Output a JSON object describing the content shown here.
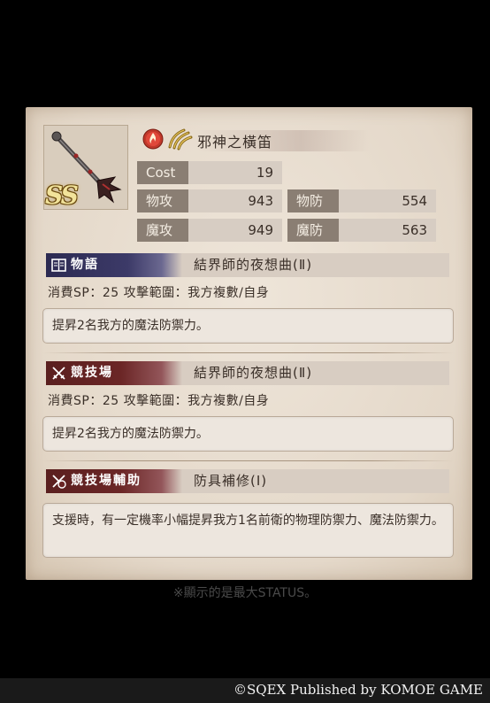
{
  "item": {
    "name": "邪神之橫笛",
    "rank": "SS",
    "element_icon": "fire-element-icon",
    "weapon_type_icon": "claw-weapon-icon"
  },
  "stats": {
    "cost_label": "Cost",
    "cost_value": "19",
    "patk_label": "物攻",
    "patk_value": "943",
    "pdef_label": "物防",
    "pdef_value": "554",
    "matk_label": "魔攻",
    "matk_value": "949",
    "mdef_label": "魔防",
    "mdef_value": "563"
  },
  "sections": [
    {
      "tag": "物語",
      "title": "結界師的夜想曲(Ⅱ)",
      "sp_line": "消費SP：25  攻擊範圍：我方複數/自身",
      "desc": "提昇2名我方的魔法防禦力。"
    },
    {
      "tag": "競技場",
      "title": "結界師的夜想曲(Ⅱ)",
      "sp_line": "消費SP：25  攻擊範圍：我方複數/自身",
      "desc": "提昇2名我方的魔法防禦力。"
    },
    {
      "tag": "競技場輔助",
      "title": "防具補修(Ⅰ)",
      "desc": "支援時，有一定機率小幅提昇我方1名前衛的物理防禦力、魔法防禦力。"
    }
  ],
  "note": "※顯示的是最大STATUS。",
  "credit": "©SQEX Published by KOMOE GAME"
}
